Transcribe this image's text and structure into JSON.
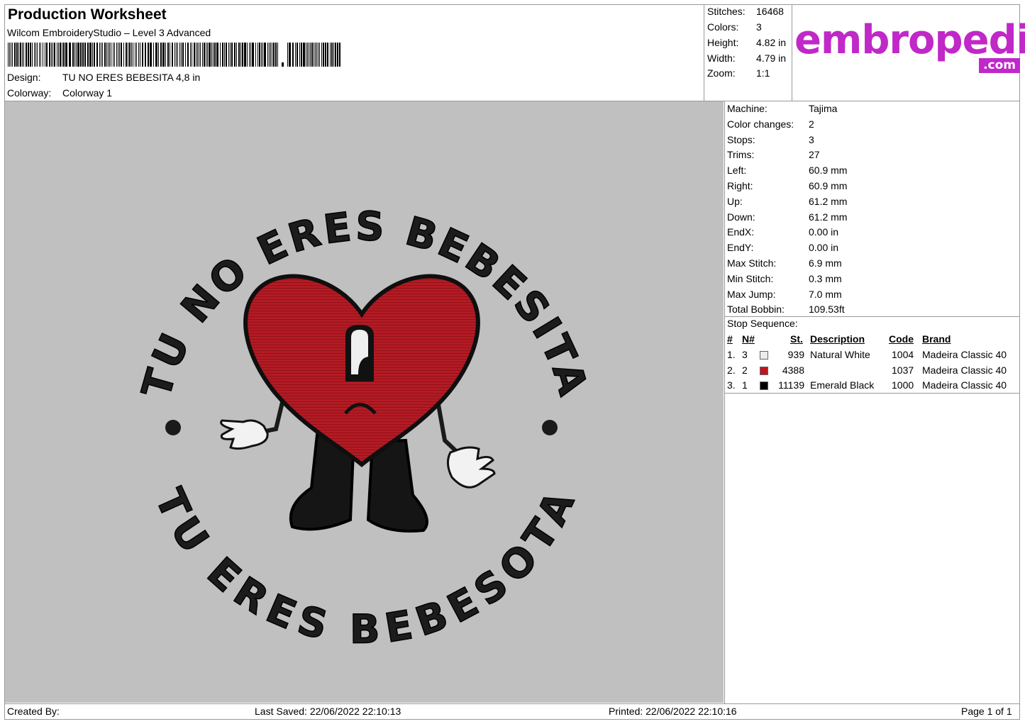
{
  "header": {
    "title": "Production Worksheet",
    "software": "Wilcom EmbroideryStudio – Level 3 Advanced",
    "design_label": "Design:",
    "design_value": "TU NO ERES BEBESITA 4,8 in",
    "colorway_label": "Colorway:",
    "colorway_value": "Colorway 1"
  },
  "stats": [
    {
      "label": "Stitches:",
      "value": "16468"
    },
    {
      "label": "Colors:",
      "value": "3"
    },
    {
      "label": "Height:",
      "value": "4.82 in"
    },
    {
      "label": "Width:",
      "value": "4.79 in"
    },
    {
      "label": "Zoom:",
      "value": "1:1"
    }
  ],
  "logo": {
    "main": "embropedia",
    "suffix": ".com",
    "color": "#c028c8"
  },
  "design_text": {
    "top": "TU NO ERES BEBESITA",
    "bottom": "TU ERES BEBESOTA"
  },
  "machine_info": [
    {
      "label": "Machine:",
      "value": "Tajima"
    },
    {
      "label": "Color changes:",
      "value": "2"
    },
    {
      "label": "Stops:",
      "value": "3"
    },
    {
      "label": "Trims:",
      "value": "27"
    },
    {
      "label": "Left:",
      "value": "60.9 mm"
    },
    {
      "label": "Right:",
      "value": "60.9 mm"
    },
    {
      "label": "Up:",
      "value": "61.2 mm"
    },
    {
      "label": "Down:",
      "value": "61.2 mm"
    },
    {
      "label": "EndX:",
      "value": "0.00 in"
    },
    {
      "label": "EndY:",
      "value": "0.00 in"
    },
    {
      "label": "Max Stitch:",
      "value": "6.9 mm"
    },
    {
      "label": "Min Stitch:",
      "value": "0.3 mm"
    },
    {
      "label": "Max Jump:",
      "value": "7.0 mm"
    },
    {
      "label": "Total Bobbin:",
      "value": "109.53ft"
    }
  ],
  "stop_sequence": {
    "title": "Stop Sequence:",
    "headers": {
      "num": "#",
      "n": "N#",
      "st": "St.",
      "desc": "Description",
      "code": "Code",
      "brand": "Brand"
    },
    "rows": [
      {
        "num": "1.",
        "n": "3",
        "color": "#ecebee",
        "st": "939",
        "desc": "Natural White",
        "code": "1004",
        "brand": "Madeira Classic 40"
      },
      {
        "num": "2.",
        "n": "2",
        "color": "#c0141e",
        "st": "4388",
        "desc": "",
        "code": "1037",
        "brand": "Madeira Classic 40"
      },
      {
        "num": "3.",
        "n": "1",
        "color": "#000000",
        "st": "11139",
        "desc": "Emerald Black",
        "code": "1000",
        "brand": "Madeira Classic 40"
      }
    ]
  },
  "footer": {
    "created_by": "Created By:",
    "last_saved": "Last Saved: 22/06/2022 22:10:13",
    "printed": "Printed: 22/06/2022 22:10:16",
    "page": "Page 1 of 1"
  }
}
